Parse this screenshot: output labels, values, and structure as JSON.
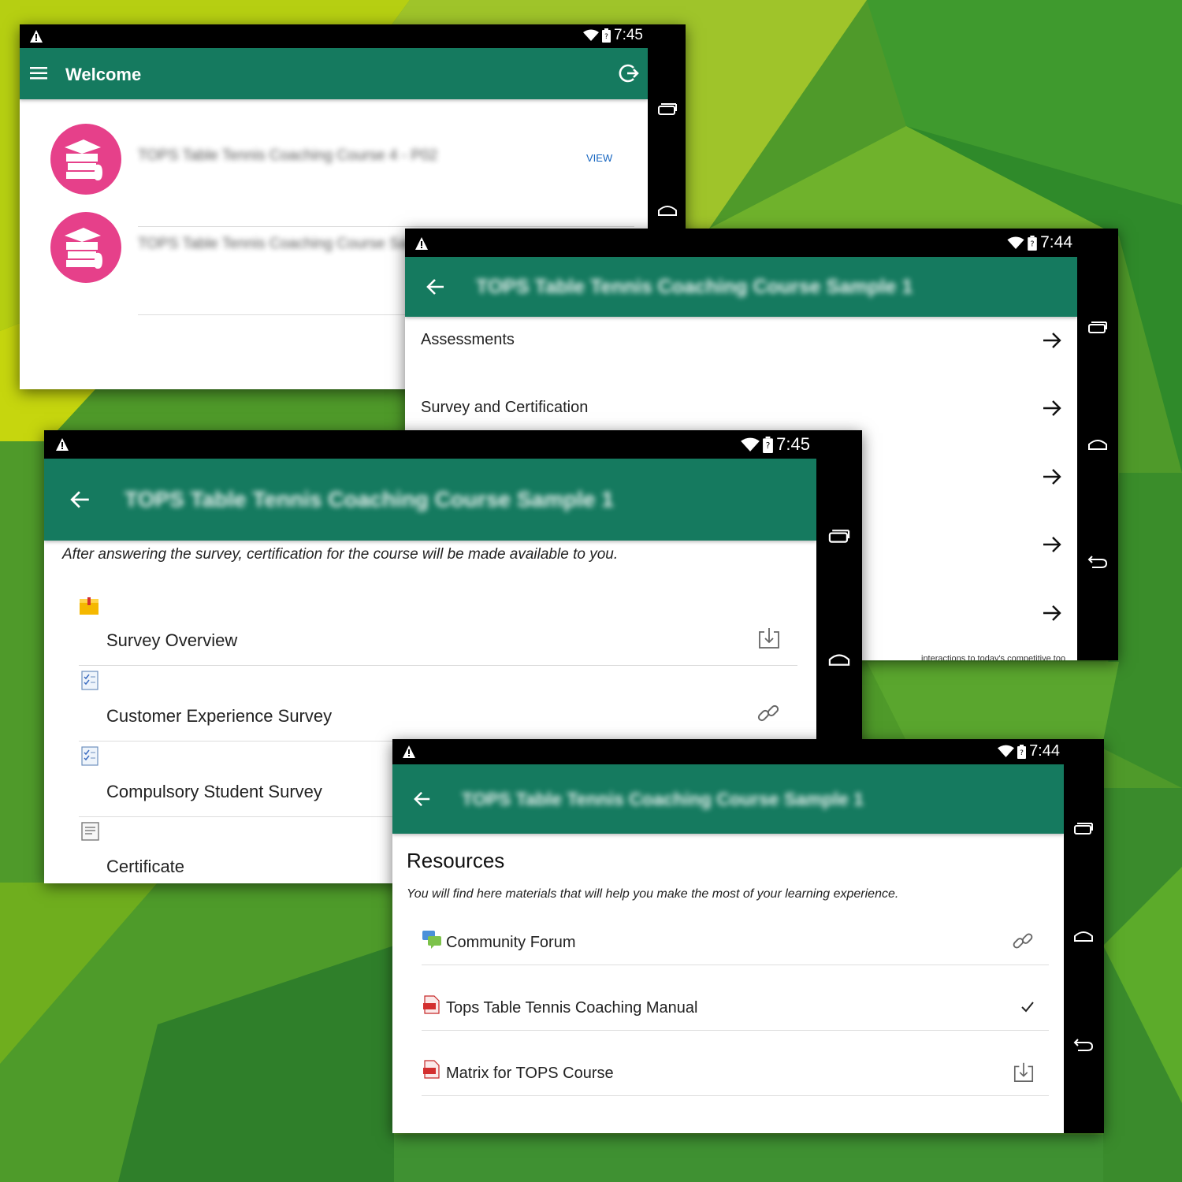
{
  "colors": {
    "app_bar": "#157a5f",
    "badge": "#e6408a",
    "view_link": "#1565c0"
  },
  "panel_welcome": {
    "time": "7:45",
    "title": "Welcome",
    "courses": [
      {
        "name": "TOPS Table Tennis Coaching Course 4 - P02",
        "action": "VIEW"
      },
      {
        "name": "TOPS Table Tennis Coaching Course Sample"
      }
    ]
  },
  "panel_modules": {
    "time": "7:44",
    "title": "TOPS Table Tennis Coaching Course Sample 1",
    "rows": [
      "Assessments",
      "Survey and Certification",
      "",
      "",
      ""
    ],
    "footer_text": "interactions to today's competitive too"
  },
  "panel_survey": {
    "time": "7:45",
    "title": "TOPS Table Tennis Coaching Course Sample 1",
    "description": "After answering the survey, certification for the course will be made available to you.",
    "items": [
      {
        "label": "Survey Overview",
        "icon": "package-icon",
        "action": "download-icon"
      },
      {
        "label": "Customer Experience Survey",
        "icon": "survey-icon",
        "action": "link-icon"
      },
      {
        "label": "Compulsory Student Survey",
        "icon": "survey-icon"
      },
      {
        "label": "Certificate",
        "icon": "certificate-icon"
      }
    ]
  },
  "panel_resources": {
    "time": "7:44",
    "title": "TOPS Table Tennis Coaching Course Sample 1",
    "heading": "Resources",
    "description": "You will find here materials that will help you make the most of your learning experience.",
    "items": [
      {
        "label": "Community Forum",
        "icon": "forum-icon",
        "action": "link-icon"
      },
      {
        "label": "Tops Table Tennis Coaching Manual",
        "icon": "pdf-icon",
        "action": "check-icon"
      },
      {
        "label": "Matrix for TOPS Course",
        "icon": "pdf-icon",
        "action": "download-icon"
      }
    ]
  }
}
